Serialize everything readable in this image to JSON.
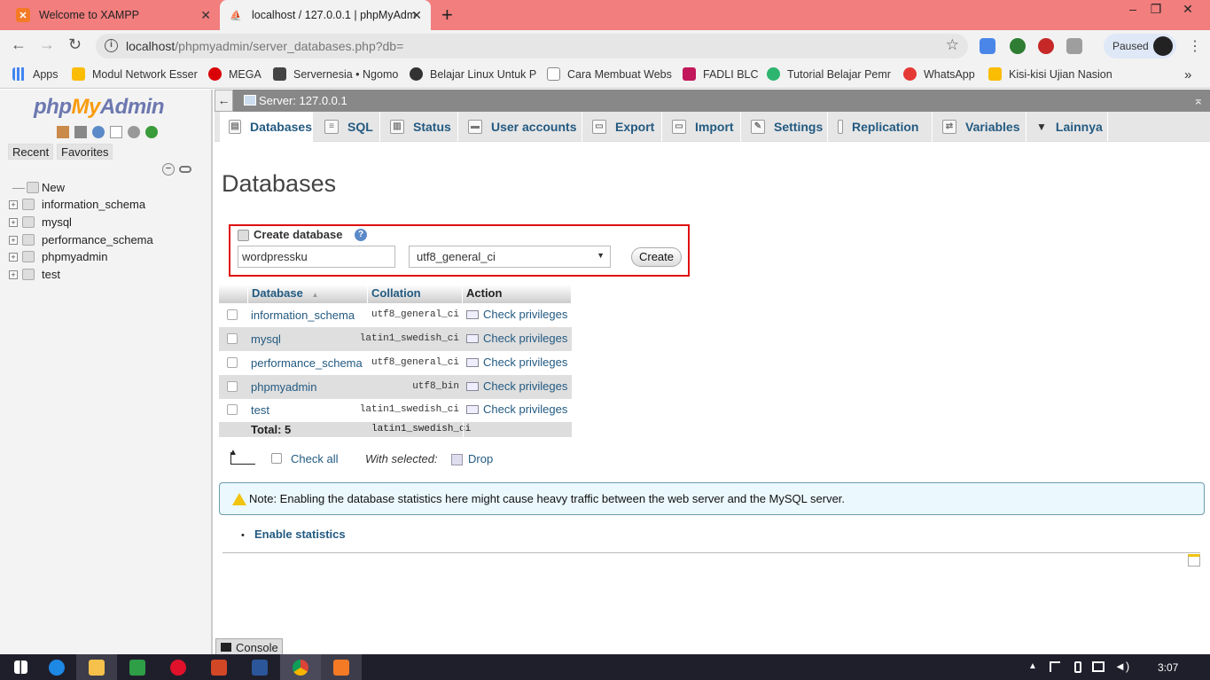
{
  "browser": {
    "tabs": [
      {
        "title": "Welcome to XAMPP",
        "active": false
      },
      {
        "title": "localhost / 127.0.0.1 | phpMyAdm",
        "active": true
      }
    ],
    "url": {
      "host": "localhost",
      "path": "/phpmyadmin/server_databases.php?db="
    },
    "profile_status": "Paused",
    "bookmarks": [
      "Apps",
      "Modul Network Esser",
      "MEGA",
      "Servernesia • Ngomo",
      "Belajar Linux Untuk P",
      "Cara Membuat Webs",
      "FADLI BLC",
      "Tutorial Belajar Pemr",
      "WhatsApp",
      "Kisi-kisi Ujian Nasion"
    ],
    "bookmarks_more": "»"
  },
  "pma": {
    "logo": {
      "part1": "php",
      "part2": "My",
      "part3": "Admin"
    },
    "left_buttons": {
      "recent": "Recent",
      "favorites": "Favorites"
    },
    "tree": [
      {
        "label": "New",
        "expandable": false
      },
      {
        "label": "information_schema",
        "expandable": true
      },
      {
        "label": "mysql",
        "expandable": true
      },
      {
        "label": "performance_schema",
        "expandable": true
      },
      {
        "label": "phpmyadmin",
        "expandable": true
      },
      {
        "label": "test",
        "expandable": true
      }
    ],
    "server_bar": "Server: 127.0.0.1",
    "nav_tabs": [
      {
        "label": "Databases",
        "icon": "database-icon",
        "active": true
      },
      {
        "label": "SQL",
        "icon": "sql-icon"
      },
      {
        "label": "Status",
        "icon": "status-icon"
      },
      {
        "label": "User accounts",
        "icon": "users-icon"
      },
      {
        "label": "Export",
        "icon": "export-icon"
      },
      {
        "label": "Import",
        "icon": "import-icon"
      },
      {
        "label": "Settings",
        "icon": "wrench-icon"
      },
      {
        "label": "Replication",
        "icon": "replication-icon"
      },
      {
        "label": "Variables",
        "icon": "variables-icon"
      },
      {
        "label": "Lainnya",
        "icon": "caret-down-icon"
      }
    ],
    "page_title": "Databases",
    "create": {
      "heading": "Create database",
      "help_icon": "?",
      "db_name_value": "wordpressku",
      "collation_value": "utf8_general_ci",
      "button": "Create"
    },
    "table": {
      "headers": {
        "database": "Database",
        "sort_indicator": "▲",
        "collation": "Collation",
        "action": "Action"
      },
      "rows": [
        {
          "name": "information_schema",
          "collation": "utf8_general_ci",
          "action": "Check privileges"
        },
        {
          "name": "mysql",
          "collation": "latin1_swedish_ci",
          "action": "Check privileges"
        },
        {
          "name": "performance_schema",
          "collation": "utf8_general_ci",
          "action": "Check privileges"
        },
        {
          "name": "phpmyadmin",
          "collation": "utf8_bin",
          "action": "Check privileges"
        },
        {
          "name": "test",
          "collation": "latin1_swedish_ci",
          "action": "Check privileges"
        }
      ],
      "total_label": "Total: 5",
      "total_collation": "latin1_swedish_ci"
    },
    "bulk": {
      "check_all": "Check all",
      "with_selected": "With selected:",
      "drop": "Drop"
    },
    "note": "Note: Enabling the database statistics here might cause heavy traffic between the web server and the MySQL server.",
    "enable_statistics": "Enable statistics",
    "console": "Console"
  },
  "taskbar": {
    "clock": "3:07"
  }
}
